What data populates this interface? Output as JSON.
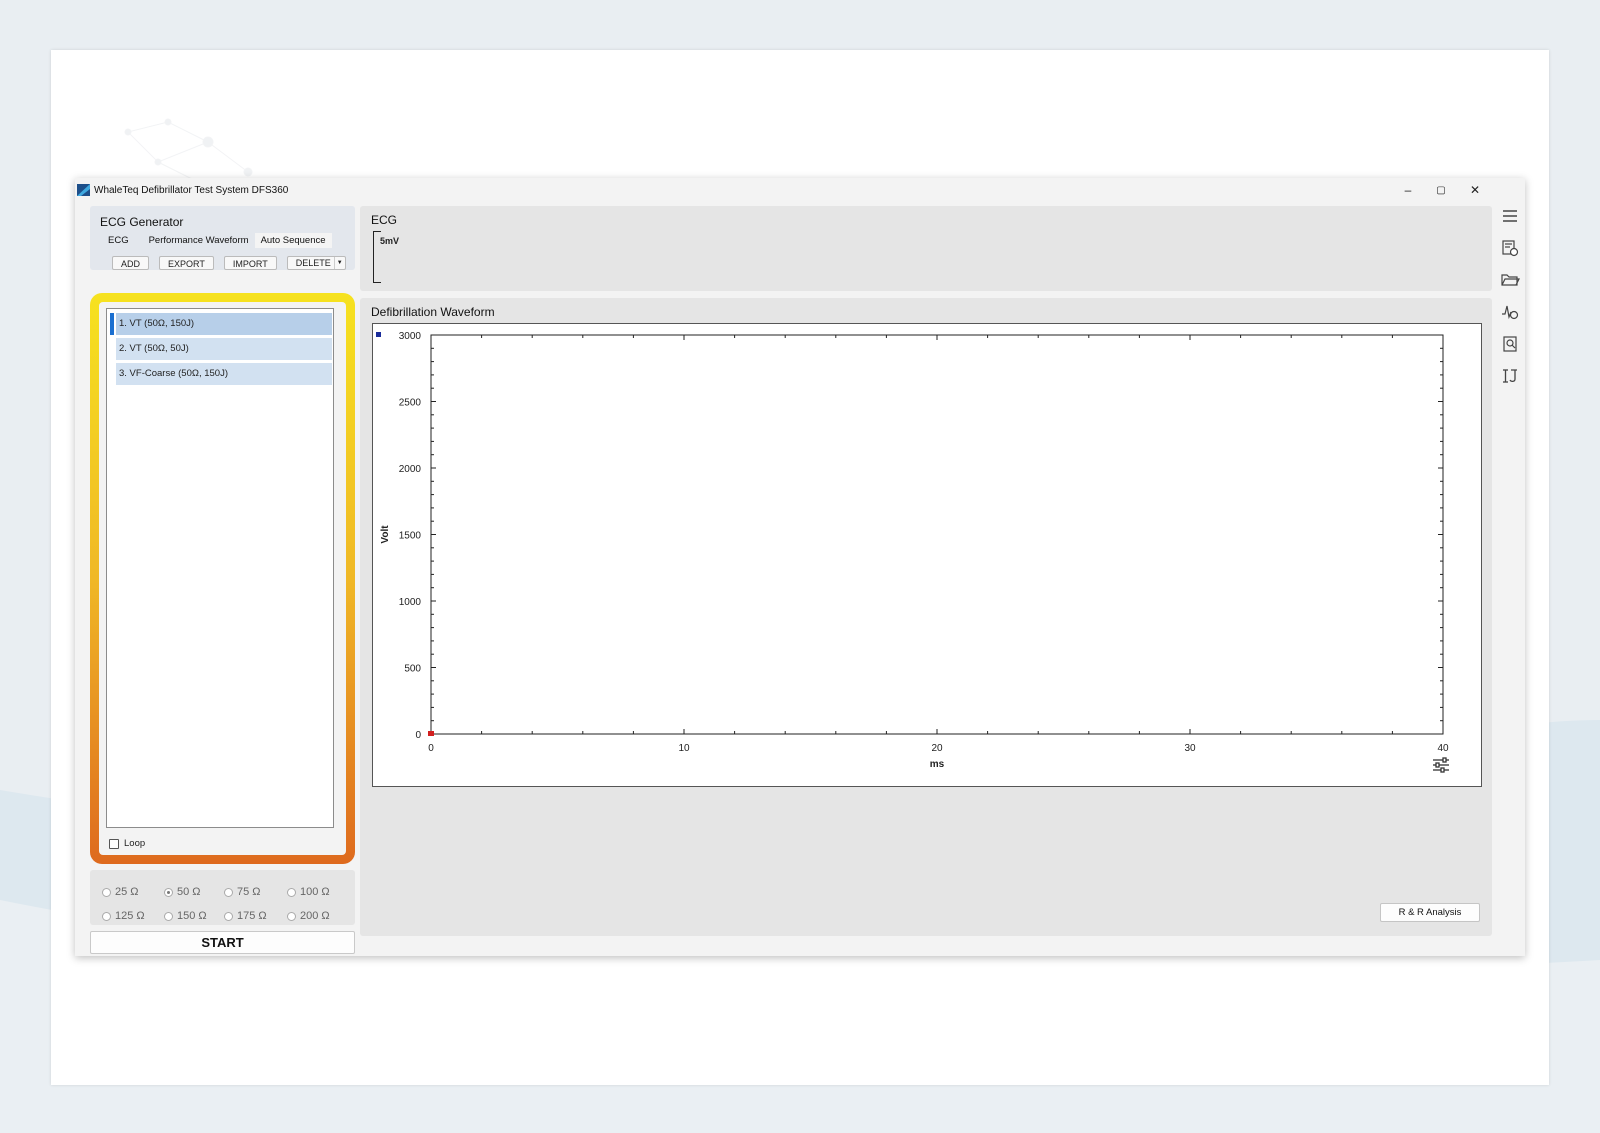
{
  "window": {
    "title": "WhaleTeq Defibrillator Test System DFS360",
    "controls": {
      "minimize": "–",
      "maximize": "▢",
      "close": "✕"
    }
  },
  "ecg_generator": {
    "title": "ECG Generator",
    "tabs": [
      "ECG",
      "Performance Waveform",
      "Auto Sequence"
    ],
    "active_tab": "Auto Sequence",
    "toolbar": {
      "add": "ADD",
      "export": "EXPORT",
      "import": "IMPORT",
      "delete": "DELETE"
    },
    "sequence": [
      "1. VT (50Ω, 150J)",
      "2. VT (50Ω, 50J)",
      "3. VF-Coarse (50Ω, 150J)"
    ],
    "selected_index": 0,
    "loop_label": "Loop",
    "loop_checked": false
  },
  "impedance": {
    "options": [
      "25 Ω",
      "50 Ω",
      "75 Ω",
      "100 Ω",
      "125 Ω",
      "150 Ω",
      "175 Ω",
      "200 Ω"
    ],
    "selected": "50 Ω"
  },
  "start_label": "START",
  "ecg_panel": {
    "title": "ECG",
    "scale_label": "5mV"
  },
  "defib_panel": {
    "title": "Defibrillation Waveform",
    "rr_button": "R & R Analysis"
  },
  "chart_data": {
    "type": "line",
    "title": "",
    "xlabel": "ms",
    "ylabel": "Volt",
    "xlim": [
      0,
      40
    ],
    "ylim": [
      0,
      3000
    ],
    "x_ticks": [
      0,
      10,
      20,
      30,
      40
    ],
    "y_ticks": [
      0,
      500,
      1000,
      1500,
      2000,
      2500,
      3000
    ],
    "series": [],
    "grid": false
  },
  "colors": {
    "highlight_top": "#f6e21f",
    "highlight_bottom": "#de6a1e",
    "selection": "#b7cfe9",
    "selection_marker": "#1a6fd0"
  },
  "rail_icons": [
    "menu-icon",
    "report-settings-icon",
    "folder-open-icon",
    "waveform-settings-icon",
    "report-search-icon",
    "calibration-icon"
  ]
}
